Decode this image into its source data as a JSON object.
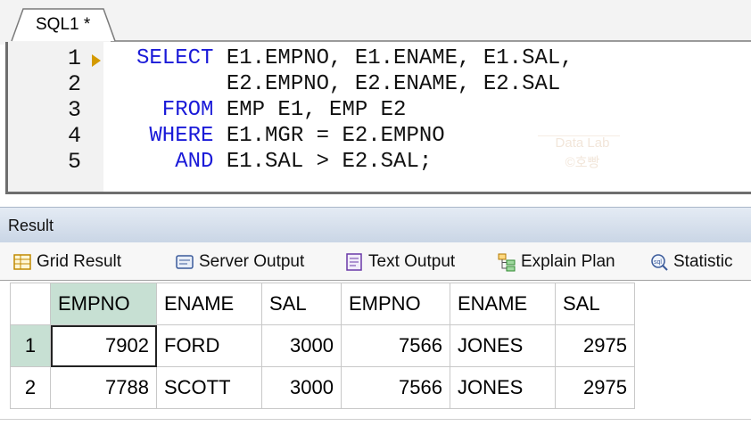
{
  "editor": {
    "tab_label": "SQL1 *",
    "line_numbers": [
      "1",
      "2",
      "3",
      "4",
      "5"
    ],
    "lines": [
      {
        "kw": "SELECT",
        "rest": " E1.EMPNO, E1.ENAME, E1.SAL,"
      },
      {
        "kw": "",
        "rest": "       E2.EMPNO, E2.ENAME, E2.SAL"
      },
      {
        "kw": "  FROM",
        "rest": " EMP E1, EMP E2"
      },
      {
        "kw": " WHERE",
        "rest": " E1.MGR = E2.EMPNO"
      },
      {
        "kw": "   AND",
        "rest": " E1.SAL > E2.SAL;"
      }
    ],
    "watermark": [
      "Data Lab",
      "©호빵"
    ]
  },
  "result": {
    "title": "Result",
    "tabs": [
      {
        "label": "Grid Result",
        "icon": "grid-icon"
      },
      {
        "label": "Server Output",
        "icon": "server-output-icon"
      },
      {
        "label": "Text Output",
        "icon": "text-output-icon"
      },
      {
        "label": "Explain Plan",
        "icon": "explain-plan-icon"
      },
      {
        "label": "Statistic",
        "icon": "statistics-icon"
      }
    ],
    "columns": [
      "EMPNO",
      "ENAME",
      "SAL",
      "EMPNO",
      "ENAME",
      "SAL"
    ],
    "rows": [
      {
        "n": "1",
        "cells": [
          "7902",
          "FORD",
          "3000",
          "7566",
          "JONES",
          "2975"
        ]
      },
      {
        "n": "2",
        "cells": [
          "7788",
          "SCOTT",
          "3000",
          "7566",
          "JONES",
          "2975"
        ]
      }
    ]
  },
  "colors": {
    "keyword": "#1a1ad8",
    "selected_header": "#c7e0d3",
    "gutter_arrow": "#d49a00"
  }
}
